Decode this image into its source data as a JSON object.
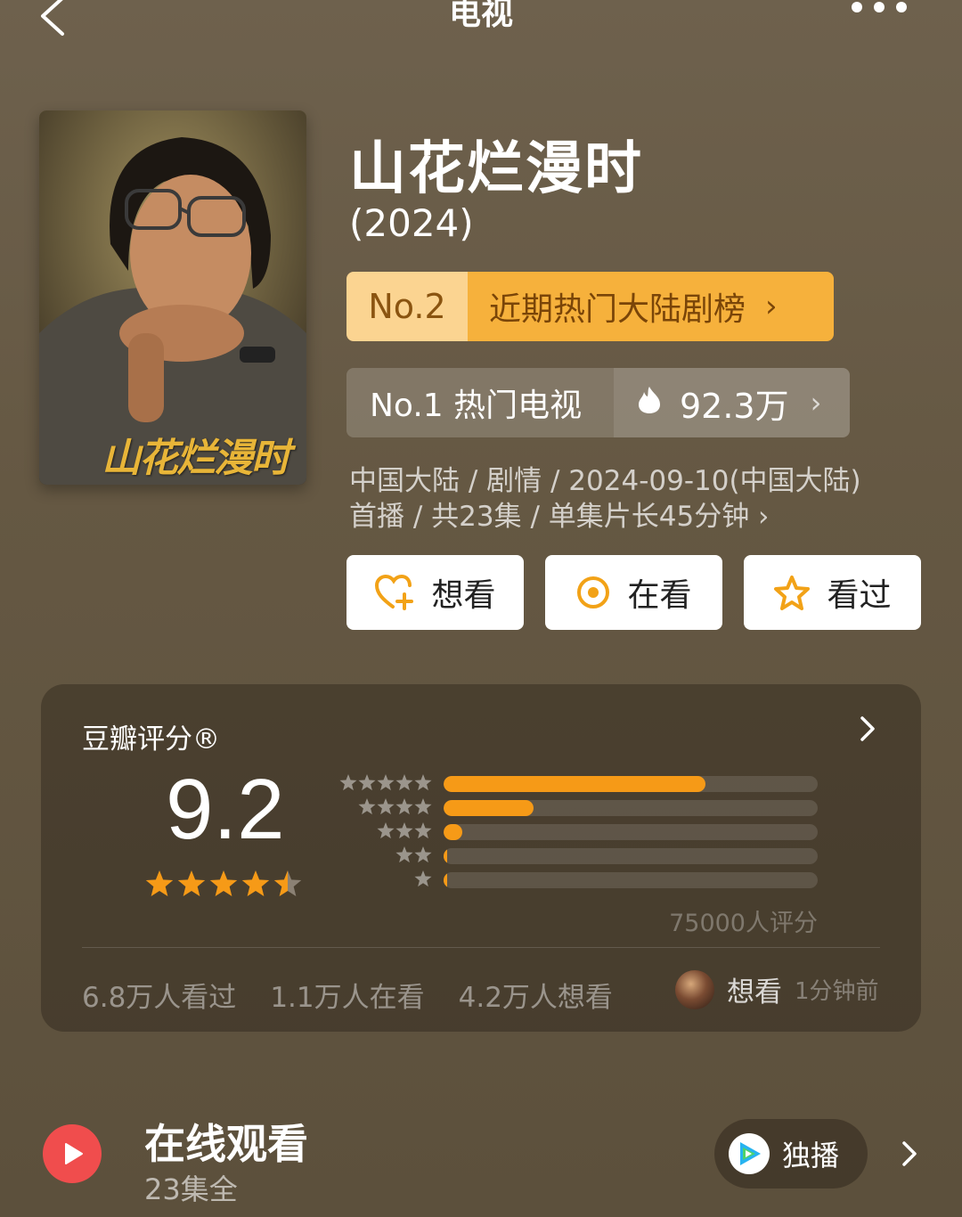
{
  "header": {
    "title": "电视"
  },
  "show": {
    "title": "山花烂漫时",
    "year": "(2024)",
    "poster_text": "山花烂漫时"
  },
  "rank": {
    "number": "No.2",
    "label": "近期热门大陆剧榜",
    "chevron": "›"
  },
  "hot": {
    "label": "No.1 热门电视",
    "count": "92.3万",
    "chevron": "›"
  },
  "meta": {
    "line1": "中国大陆 / 剧情 / 2024-09-10(中国大陆)",
    "line2": "首播 / 共23集 / 单集片长45分钟 ›"
  },
  "actions": {
    "want": "想看",
    "watching": "在看",
    "watched": "看过"
  },
  "rating": {
    "title": "豆瓣评分®",
    "score": "9.2",
    "stars_value": 4.5,
    "count_label": "75000人评分",
    "distribution": [
      {
        "stars": 5,
        "fraction": 0.7
      },
      {
        "stars": 4,
        "fraction": 0.24
      },
      {
        "stars": 3,
        "fraction": 0.05
      },
      {
        "stars": 2,
        "fraction": 0.005
      },
      {
        "stars": 1,
        "fraction": 0.005
      }
    ],
    "stats": {
      "watched": "6.8万人看过",
      "watching": "1.1万人在看",
      "want": "4.2万人想看"
    },
    "recent": {
      "action": "想看",
      "time": "1分钟前"
    }
  },
  "watch": {
    "title": "在线观看",
    "subtitle": "23集全",
    "exclusive_label": "独播"
  },
  "colors": {
    "accent_orange": "#f69a17",
    "rank_light": "#fbd491",
    "rank_dark": "#f6b13c",
    "play_red": "#f04d4d"
  },
  "icons": {
    "back": "back-arrow-icon",
    "more": "more-dots-icon",
    "flame": "flame-icon",
    "want": "heart-plus-icon",
    "watching": "target-icon",
    "watched": "star-outline-icon",
    "play": "play-icon",
    "platform": "tencent-video-icon"
  }
}
